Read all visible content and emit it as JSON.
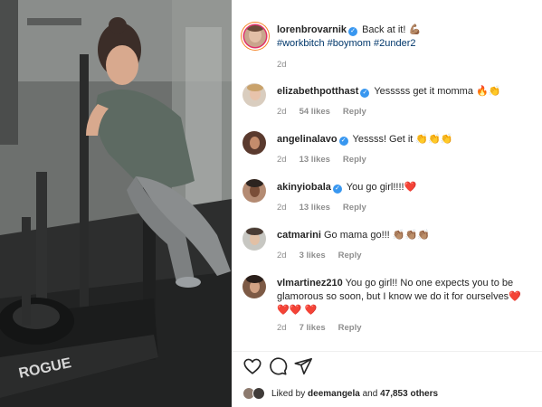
{
  "post": {
    "author": "lorenbrovarnik",
    "caption": "Back at it! 💪🏽",
    "hashtags": "#workbitch #boymom #2under2",
    "age": "2d"
  },
  "comments": [
    {
      "user": "elizabethpotthast",
      "verified": true,
      "text": "Yesssss get it momma 🔥👏",
      "age": "2d",
      "likes": "54 likes",
      "reply": "Reply"
    },
    {
      "user": "angelinalavo",
      "verified": true,
      "text": "Yessss! Get it 👏👏👏",
      "age": "2d",
      "likes": "13 likes",
      "reply": "Reply"
    },
    {
      "user": "akinyiobala",
      "verified": true,
      "text": "You go girl!!!!❤️",
      "age": "2d",
      "likes": "13 likes",
      "reply": "Reply"
    },
    {
      "user": "catmarini",
      "verified": false,
      "text": "Go mama go!!! 👏🏽👏🏽👏🏽",
      "age": "2d",
      "likes": "3 likes",
      "reply": "Reply"
    },
    {
      "user": "vlmartinez210",
      "verified": false,
      "text": "You go girl!! No one expects you to be glamorous so soon, but I know we do it for ourselves❤️❤️❤️ ❤️",
      "age": "2d",
      "likes": "7 likes",
      "reply": "Reply"
    }
  ],
  "likes_line": {
    "prefix": "Liked by ",
    "user": "deemangela",
    "middle": " and ",
    "count": "47,853 others"
  },
  "photo": {
    "equipment_brand": "ROGUE"
  },
  "icons": {
    "like": "heart-icon",
    "comment": "comment-icon",
    "share": "share-icon",
    "verified": "verified-badge-icon"
  },
  "colors": {
    "link": "#00376b",
    "verified": "#3897f0",
    "meta": "#8e8e8e",
    "heart": "#ed4956"
  }
}
